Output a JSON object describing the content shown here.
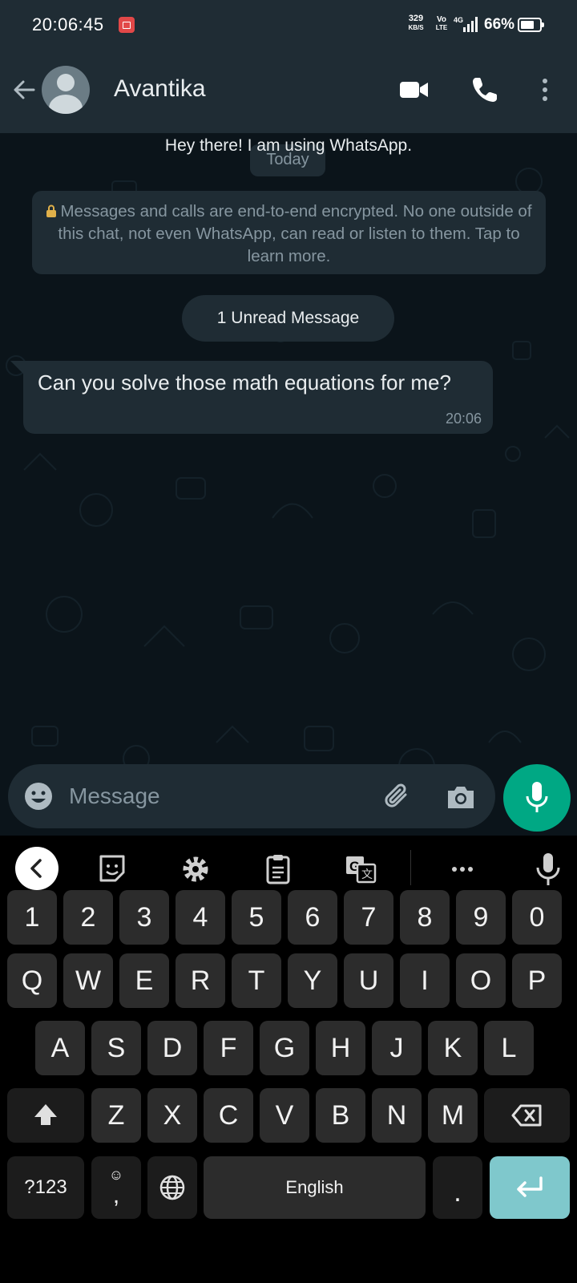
{
  "status_bar": {
    "time": "20:06:45",
    "speed_top": "329",
    "speed_bottom": "KB/S",
    "volte_top": "Vo",
    "volte_bottom": "LTE",
    "battery": "66%"
  },
  "header": {
    "contact_name": "Avantika",
    "status_about": "Hey there! I am using WhatsApp."
  },
  "chat": {
    "date_pill": "Today",
    "encryption_notice": "Messages and calls are end-to-end encrypted. No one outside of this chat, not even WhatsApp, can read or listen to them. Tap to learn more.",
    "unread_label": "1 Unread Message",
    "messages": [
      {
        "text": "Can you solve those math equations for me?",
        "time": "20:06",
        "direction": "incoming"
      }
    ]
  },
  "composer": {
    "placeholder": "Message"
  },
  "keyboard": {
    "row_numbers": [
      "1",
      "2",
      "3",
      "4",
      "5",
      "6",
      "7",
      "8",
      "9",
      "0"
    ],
    "row_top": [
      "Q",
      "W",
      "E",
      "R",
      "T",
      "Y",
      "U",
      "I",
      "O",
      "P"
    ],
    "row_middle": [
      "A",
      "S",
      "D",
      "F",
      "G",
      "H",
      "J",
      "K",
      "L"
    ],
    "row_bottom": [
      "Z",
      "X",
      "C",
      "V",
      "B",
      "N",
      "M"
    ],
    "symbols_key": "?123",
    "comma_key": ",",
    "space_label": "English",
    "period_key": "."
  },
  "colors": {
    "accent": "#00a884",
    "header_bg": "#1f2c34",
    "chat_bg": "#0b141a",
    "enter_key": "#7fc8cc"
  }
}
